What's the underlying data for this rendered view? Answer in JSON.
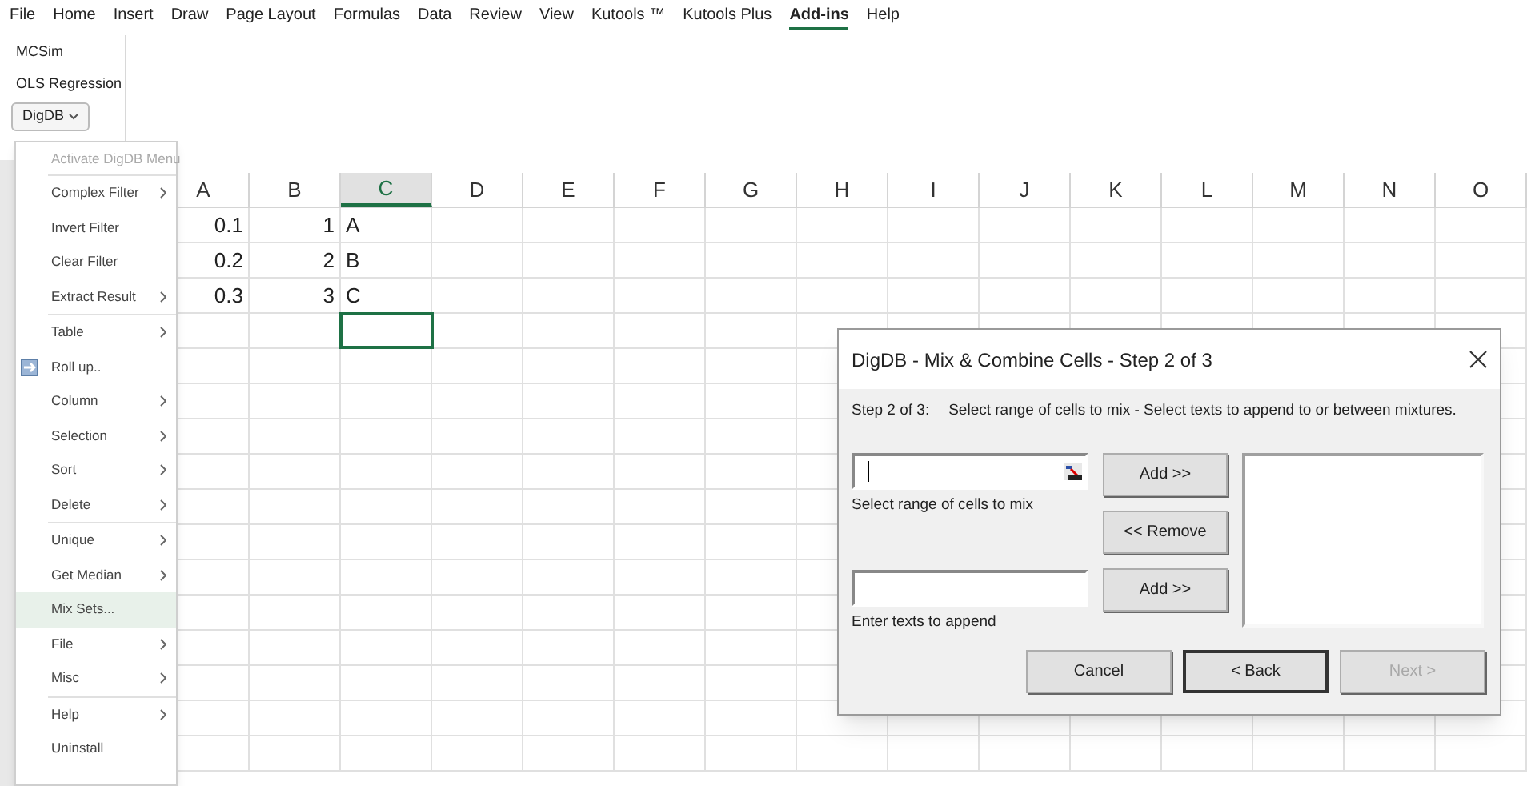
{
  "menu_bar": [
    {
      "label": "File",
      "selected": false
    },
    {
      "label": "Home",
      "selected": false
    },
    {
      "label": "Insert",
      "selected": false
    },
    {
      "label": "Draw",
      "selected": false
    },
    {
      "label": "Page Layout",
      "selected": false
    },
    {
      "label": "Formulas",
      "selected": false
    },
    {
      "label": "Data",
      "selected": false
    },
    {
      "label": "Review",
      "selected": false
    },
    {
      "label": "View",
      "selected": false
    },
    {
      "label": "Kutools ™",
      "selected": false
    },
    {
      "label": "Kutools Plus",
      "selected": false
    },
    {
      "label": "Add-ins",
      "selected": true
    },
    {
      "label": "Help",
      "selected": false
    }
  ],
  "ribbon": {
    "items": [
      "MCSim",
      "OLS Regression"
    ],
    "dropdown": {
      "label": "DigDB"
    }
  },
  "menu": {
    "header": {
      "label": "Activate DigDB Menu",
      "disabled": true
    },
    "sections": [
      [
        {
          "label": "Complex Filter",
          "submenu": true,
          "has_icon": false,
          "selected": false
        },
        {
          "label": "Invert Filter",
          "submenu": false,
          "has_icon": false,
          "selected": false
        },
        {
          "label": "Clear Filter",
          "submenu": false,
          "has_icon": false,
          "selected": false
        },
        {
          "label": "Extract Result",
          "submenu": true,
          "has_icon": false,
          "selected": false
        }
      ],
      [
        {
          "label": "Table",
          "submenu": true,
          "has_icon": false,
          "selected": false
        },
        {
          "label": "Roll up..",
          "submenu": false,
          "has_icon": true,
          "selected": false
        },
        {
          "label": "Column",
          "submenu": true,
          "has_icon": false,
          "selected": false
        },
        {
          "label": "Selection",
          "submenu": true,
          "has_icon": false,
          "selected": false
        },
        {
          "label": "Sort",
          "submenu": true,
          "has_icon": false,
          "selected": false
        },
        {
          "label": "Delete",
          "submenu": true,
          "has_icon": false,
          "selected": false
        }
      ],
      [
        {
          "label": "Unique",
          "submenu": true,
          "has_icon": false,
          "selected": false
        },
        {
          "label": "Get Median",
          "submenu": true,
          "has_icon": false,
          "selected": false
        },
        {
          "label": "Mix Sets...",
          "submenu": false,
          "has_icon": false,
          "selected": true
        },
        {
          "label": "File",
          "submenu": true,
          "has_icon": false,
          "selected": false
        },
        {
          "label": "Misc",
          "submenu": true,
          "has_icon": false,
          "selected": false
        }
      ],
      [
        {
          "label": "Help",
          "submenu": true,
          "has_icon": false,
          "selected": false
        },
        {
          "label": "Uninstall",
          "submenu": false,
          "has_icon": false,
          "selected": false
        }
      ]
    ]
  },
  "sheet": {
    "columns": [
      {
        "label": "A",
        "selected": false
      },
      {
        "label": "B",
        "selected": false
      },
      {
        "label": "C",
        "selected": true
      },
      {
        "label": "D",
        "selected": false
      },
      {
        "label": "E",
        "selected": false
      },
      {
        "label": "F",
        "selected": false
      },
      {
        "label": "G",
        "selected": false
      },
      {
        "label": "H",
        "selected": false
      },
      {
        "label": "I",
        "selected": false
      },
      {
        "label": "J",
        "selected": false
      },
      {
        "label": "K",
        "selected": false
      },
      {
        "label": "L",
        "selected": false
      },
      {
        "label": "M",
        "selected": false
      },
      {
        "label": "N",
        "selected": false
      },
      {
        "label": "O",
        "selected": false
      }
    ],
    "rows": [
      {
        "cells": [
          {
            "kind": "number",
            "text": "0.1",
            "selected": false
          },
          {
            "kind": "number",
            "text": "1",
            "selected": false
          },
          {
            "kind": "text",
            "text": "A",
            "selected": false
          }
        ]
      },
      {
        "cells": [
          {
            "kind": "number",
            "text": "0.2",
            "selected": false
          },
          {
            "kind": "number",
            "text": "2",
            "selected": false
          },
          {
            "kind": "text",
            "text": "B",
            "selected": false
          }
        ]
      },
      {
        "cells": [
          {
            "kind": "number",
            "text": "0.3",
            "selected": false
          },
          {
            "kind": "number",
            "text": "3",
            "selected": false
          },
          {
            "kind": "text",
            "text": "C",
            "selected": false
          }
        ]
      },
      {
        "cells": [
          {
            "kind": "blank"
          },
          {
            "kind": "blank"
          },
          {
            "kind": "empty",
            "selected": true
          }
        ]
      }
    ]
  },
  "dialog": {
    "title": "DigDB - Mix & Combine Cells - Step 2 of 3",
    "step": "Step 2 of 3:",
    "instruction": "Select range of cells to mix - Select texts to append to or between mixtures.",
    "range_field": {
      "label": "Select range of cells to mix",
      "focused": true
    },
    "append_field": {
      "label": "Enter texts to append"
    },
    "side_buttons": [
      "Add >>",
      "<< Remove",
      "Add >>"
    ],
    "footer_buttons": [
      {
        "label": "Cancel",
        "default": false,
        "disabled": false
      },
      {
        "label": "< Back",
        "default": true,
        "disabled": false
      },
      {
        "label": "Next >",
        "default": false,
        "disabled": true
      }
    ]
  }
}
